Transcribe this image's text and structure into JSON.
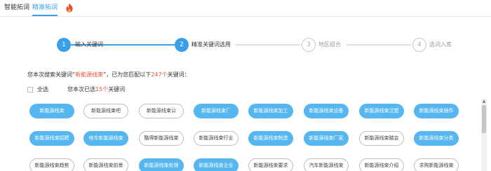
{
  "tabs": {
    "smart": "智能拓词",
    "precise": "精准拓词",
    "hot_icon": "fire-icon"
  },
  "steps": [
    {
      "num": "1",
      "label": "输入关键词",
      "state": "active"
    },
    {
      "num": "2",
      "label": "精准关键词选用",
      "state": "active"
    },
    {
      "num": "3",
      "label": "地区组合",
      "state": "inactive"
    },
    {
      "num": "4",
      "label": "选词入库",
      "state": "inactive"
    }
  ],
  "summary": {
    "prefix": "您本次搜索关键词“",
    "keyword": "新能源线束",
    "mid": "”，已为您匹配以下",
    "count": "247个",
    "suffix": "关键词："
  },
  "select": {
    "select_all": "全选",
    "prefix": "您本次已选",
    "count": "15个",
    "suffix": "关键词"
  },
  "keywords": [
    {
      "text": "新能源线束",
      "selected": true
    },
    {
      "text": "新能源线束吧",
      "selected": false
    },
    {
      "text": "新能源线束公",
      "selected": false
    },
    {
      "text": "新能源线束厂",
      "selected": true
    },
    {
      "text": "新能源线束加工",
      "selected": true
    },
    {
      "text": "新能源线束设备",
      "selected": true
    },
    {
      "text": "新能源线束注塑",
      "selected": true
    },
    {
      "text": "新能源线束插件",
      "selected": true
    },
    {
      "text": "新能源线束招聘",
      "selected": true
    },
    {
      "text": "电车新能源线束",
      "selected": true
    },
    {
      "text": "酷得新能源线束",
      "selected": false
    },
    {
      "text": "新能源线束行业",
      "selected": false
    },
    {
      "text": "新能源线束制造",
      "selected": true
    },
    {
      "text": "新能源线束厂家",
      "selected": true
    },
    {
      "text": "新能源线束踏会",
      "selected": false
    },
    {
      "text": "新能源线束分类",
      "selected": true
    },
    {
      "text": "新能源线束趋势",
      "selected": false
    },
    {
      "text": "新能源线束前景",
      "selected": false
    },
    {
      "text": "新能源线束处理",
      "selected": true
    },
    {
      "text": "新能源线束企业",
      "selected": true
    },
    {
      "text": "新能源线束要求",
      "selected": false
    },
    {
      "text": "汽车新能源线束",
      "selected": false
    },
    {
      "text": "新能源线束介绍",
      "selected": false
    },
    {
      "text": "求购新能源线束",
      "selected": false
    }
  ],
  "colors": {
    "accent": "#3a9fe8",
    "chip_selected": "#56b6f0",
    "highlight": "#e8543a"
  }
}
